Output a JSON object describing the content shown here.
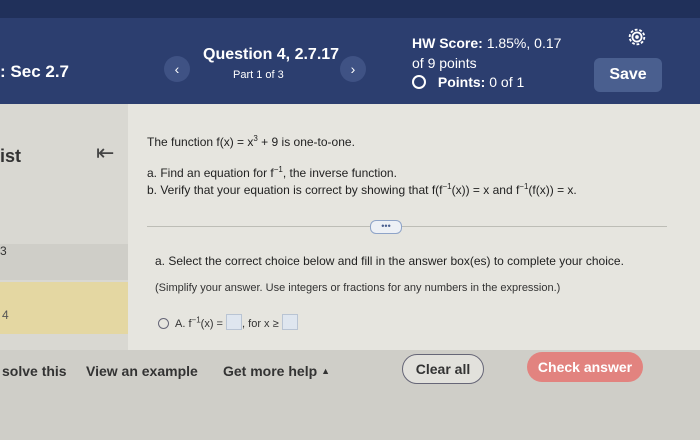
{
  "header": {
    "course": "Sec 2.7",
    "course_prefix": ":",
    "prev_icon": "chevron-left-icon",
    "next_icon": "chevron-right-icon",
    "question_title": "Question 4, 2.7.17",
    "question_part": "Part 1 of 3",
    "hw_score_label": "HW Score:",
    "hw_score_value": "1.85%, 0.17",
    "hw_points_total": "of 9 points",
    "points_label": "Points:",
    "points_value": "0 of 1",
    "settings_icon": "gear-icon",
    "save_label": "Save"
  },
  "sidebar": {
    "list_label": "ist",
    "item_3": "3",
    "item_4": "4",
    "collapse_icon": "collapse-left-icon"
  },
  "question": {
    "statement_pre": "The function f(x) = x",
    "statement_exp": "3",
    "statement_post": " + 9 is one-to-one.",
    "part_a_pre": "a. Find an equation for f",
    "part_a_exp": "−1",
    "part_a_post": ", the inverse function.",
    "part_b_pre": "b. Verify that your equation is correct by showing that f(f",
    "part_b_exp1": "−1",
    "part_b_mid": "(x)) = x and f",
    "part_b_exp2": "−1",
    "part_b_post": "(f(x)) = x.",
    "more_dots": "•••"
  },
  "answer": {
    "instruction": "a. Select the correct choice below and fill in the answer box(es) to complete your choice.",
    "hint": "(Simplify your answer. Use integers or fractions for any numbers in the expression.)",
    "choice_a_label": "A.",
    "choice_a_pre": "f",
    "choice_a_exp": "−1",
    "choice_a_mid": "(x) =",
    "choice_a_cond": ", for x ≥"
  },
  "footer": {
    "solve": "solve this",
    "example": "View an example",
    "help": "Get more help",
    "help_caret": "▲",
    "clear": "Clear all",
    "check": "Check answer"
  },
  "colors": {
    "header_bg": "#2c3e6f",
    "check_button": "#e2837f",
    "save_button": "#4a5f8f"
  }
}
